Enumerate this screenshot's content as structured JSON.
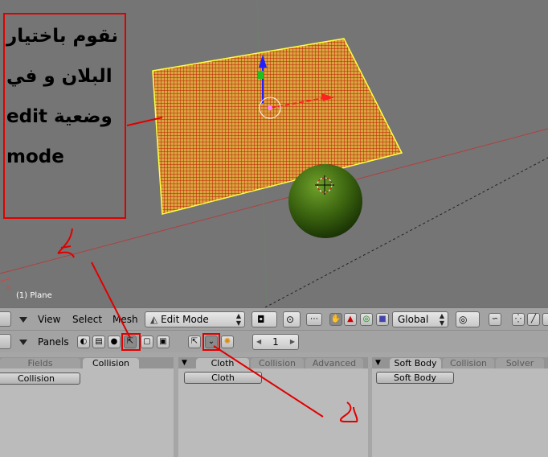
{
  "viewport": {
    "object_label": "(1) Plane"
  },
  "annotation": {
    "lines": [
      "نقوم باختيار",
      "البلان و في",
      "وضعية edit",
      "mode"
    ]
  },
  "header": {
    "menus": [
      "View",
      "Select",
      "Mesh"
    ],
    "mode": "Edit Mode",
    "orientation": "Global"
  },
  "subheader": {
    "panels_label": "Panels",
    "frame": "1"
  },
  "panels": {
    "physics_left": {
      "tabs": [
        "Fields",
        "Collision"
      ],
      "button": "Collision"
    },
    "cloth": {
      "tabs": [
        "Cloth",
        "Collision",
        "Advanced"
      ],
      "button": "Cloth"
    },
    "softbody": {
      "tabs": [
        "Soft Body",
        "Collision",
        "Solver"
      ],
      "button": "Soft Body"
    }
  },
  "colors": {
    "viewport_bg": "#757575",
    "plane_fill": "#c8a040",
    "plane_wire": "#ff2a00",
    "sphere": "#3f6a10",
    "annotation": "#e00000"
  }
}
